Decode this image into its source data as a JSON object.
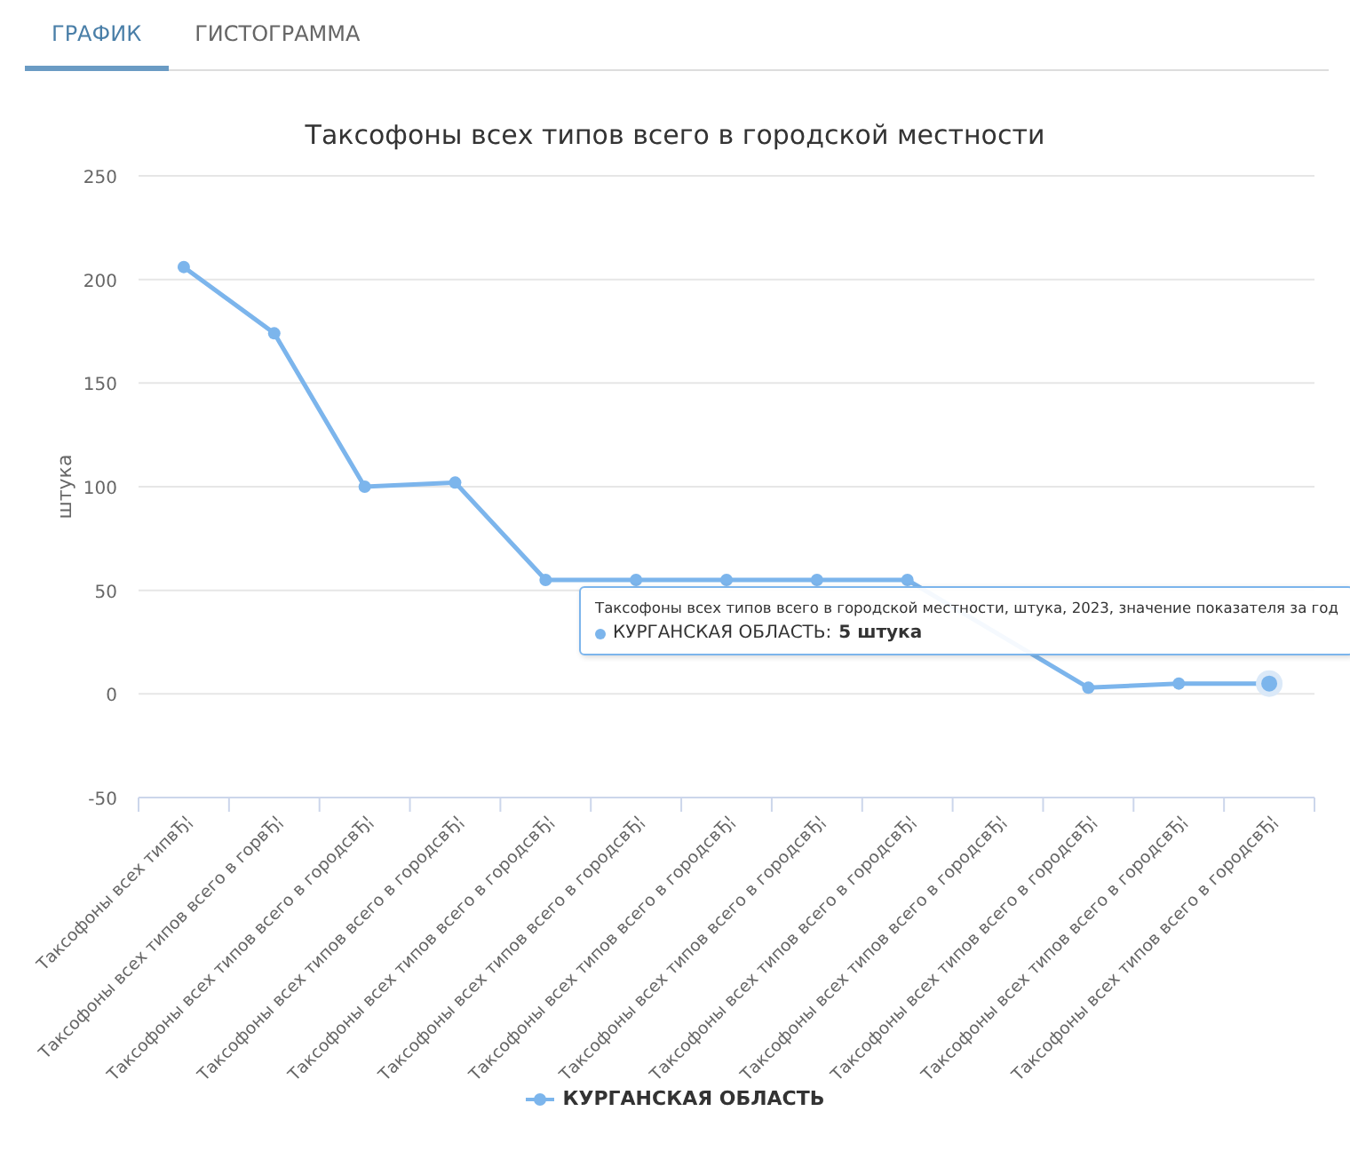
{
  "tabs": [
    {
      "label": "ГРАФИК",
      "selected": true
    },
    {
      "label": "ГИСТОГРАММА",
      "selected": false
    }
  ],
  "chart": {
    "chart_data": {
      "type": "line",
      "title": "Таксофоны всех типов всего в городской местности",
      "ylabel": "штука",
      "categories": [
        "Таксофоны всех типвЂ¦",
        "Таксофоны всех типов всего в горвЂ¦",
        "Таксофоны всех типов всего в городсвЂ¦",
        "Таксофоны всех типов всего в городсвЂ¦",
        "Таксофоны всех типов всего в городсвЂ¦",
        "Таксофоны всех типов всего в городсвЂ¦",
        "Таксофоны всех типов всего в городсвЂ¦",
        "Таксофоны всех типов всего в городсвЂ¦",
        "Таксофоны всех типов всего в городсвЂ¦",
        "Таксофоны всех типов всего в городсвЂ¦",
        "Таксофоны всех типов всего в городсвЂ¦",
        "Таксофоны всех типов всего в городсвЂ¦",
        "Таксофоны всех типов всего в городсвЂ¦"
      ],
      "series": [
        {
          "name": "КУРГАНСКАЯ ОБЛАСТЬ",
          "color": "#7cb5ec",
          "marker": true,
          "values": [
            206,
            174,
            100,
            102,
            55,
            55,
            55,
            55,
            55,
            null,
            3,
            5,
            5
          ]
        }
      ],
      "grid": true,
      "ylim": [
        -50,
        250
      ],
      "yticks": [
        -50,
        0,
        50,
        100,
        150,
        200,
        250
      ]
    },
    "tooltip": {
      "header": "Таксофоны всех типов всего в городской местности, штука, 2023, значение показателя за год",
      "series_label": "КУРГАНСКАЯ ОБЛАСТЬ: ",
      "value": "5 штука"
    }
  }
}
